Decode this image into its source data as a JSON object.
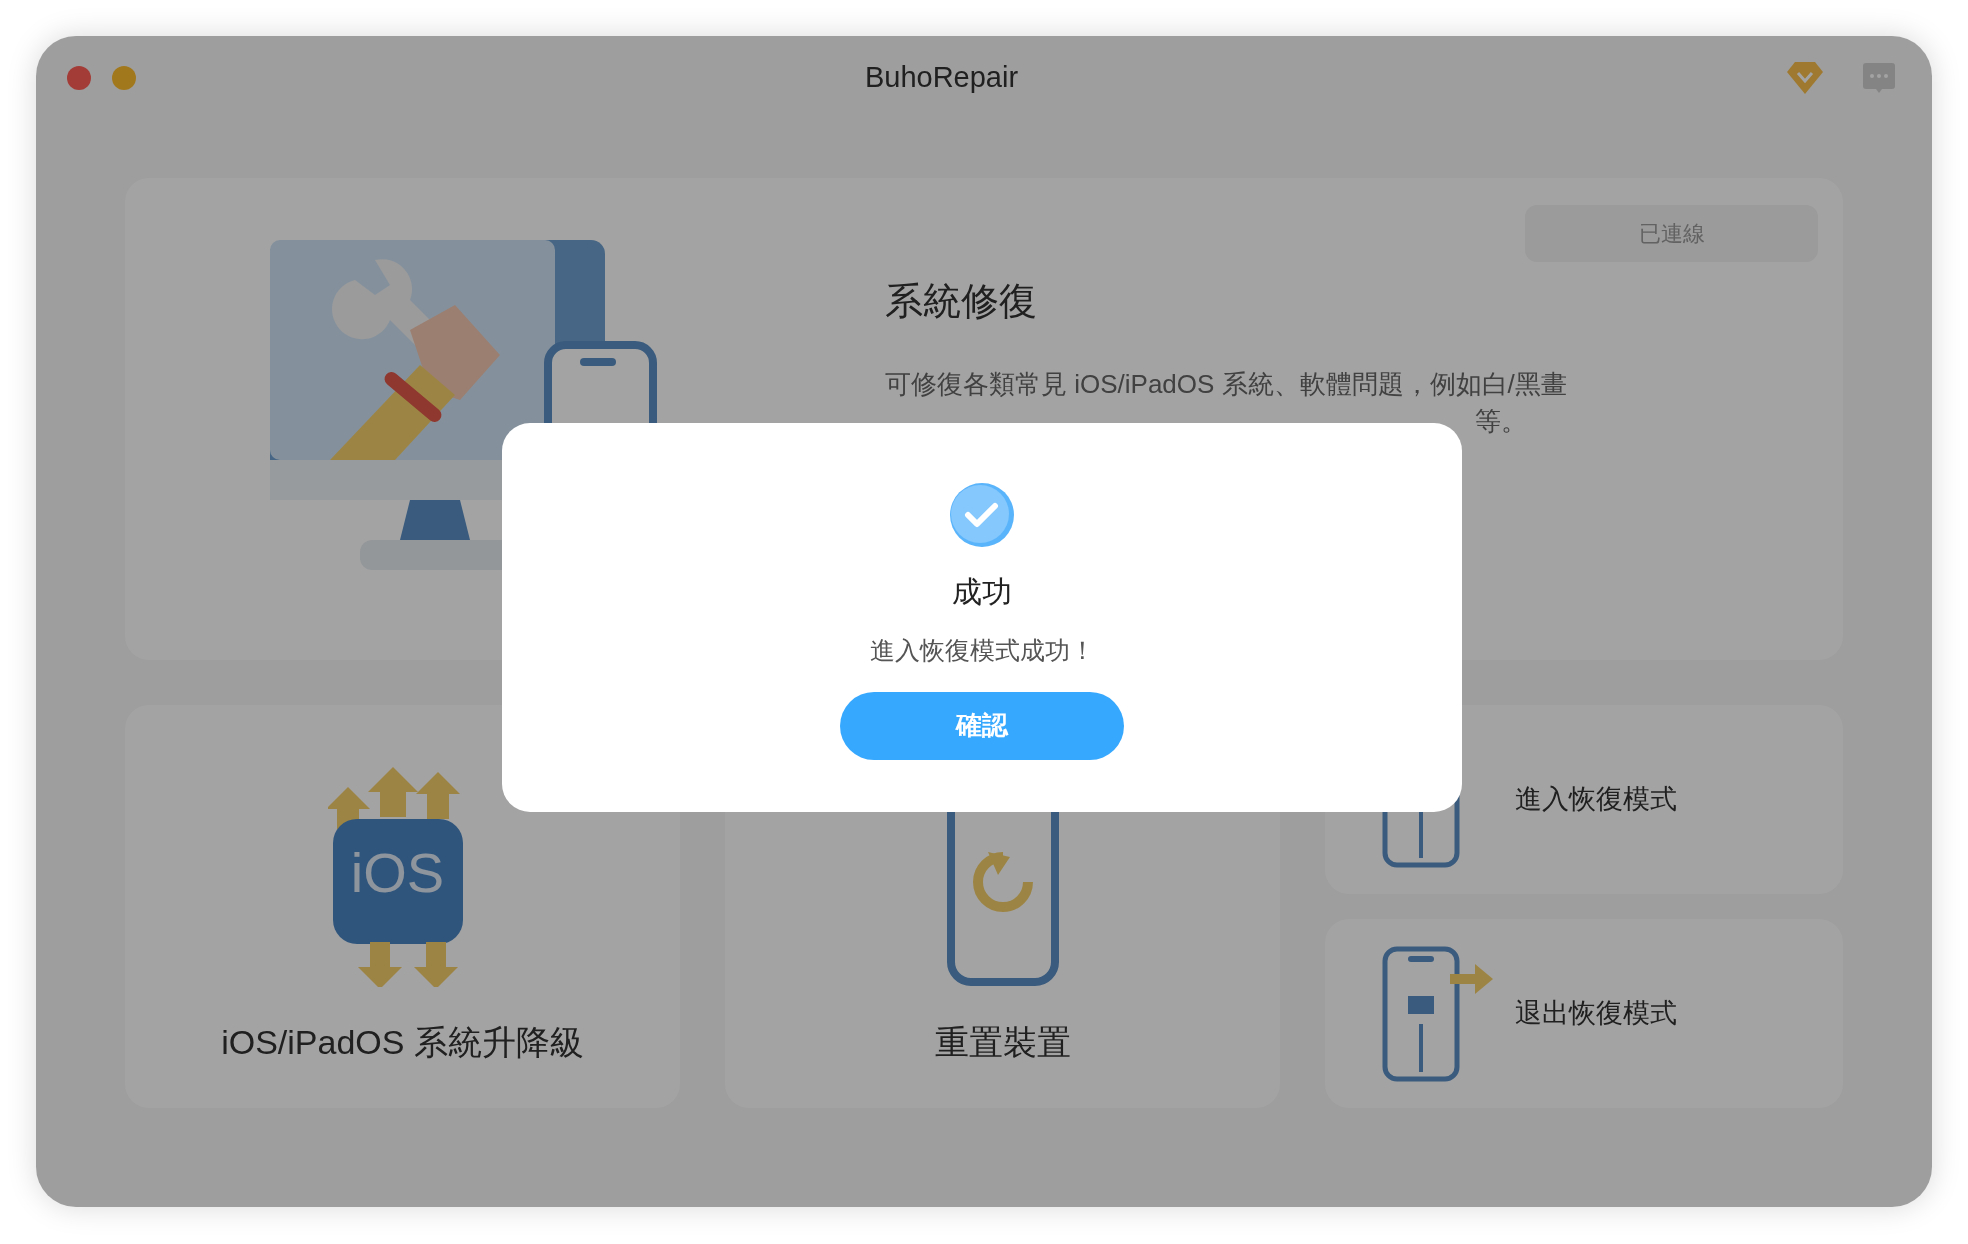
{
  "window": {
    "title": "BuhoRepair"
  },
  "repair_card": {
    "status_badge": "已連線",
    "title": "系統修復",
    "description": "可修復各類常見 iOS/iPadOS 系統、軟體問題，例如白/黑畫",
    "description_end": "等。"
  },
  "tools": [
    {
      "kind": "upgrade",
      "label": "iOS/iPadOS 系統升降級",
      "icon_text": "iOS"
    },
    {
      "kind": "reset",
      "label": "重置裝置"
    },
    {
      "kind": "enter_recovery",
      "label": "進入恢復模式"
    },
    {
      "kind": "exit_recovery",
      "label": "退出恢復模式"
    }
  ],
  "dialog": {
    "title": "成功",
    "message": "進入恢復模式成功！",
    "confirm_button": "確認"
  }
}
